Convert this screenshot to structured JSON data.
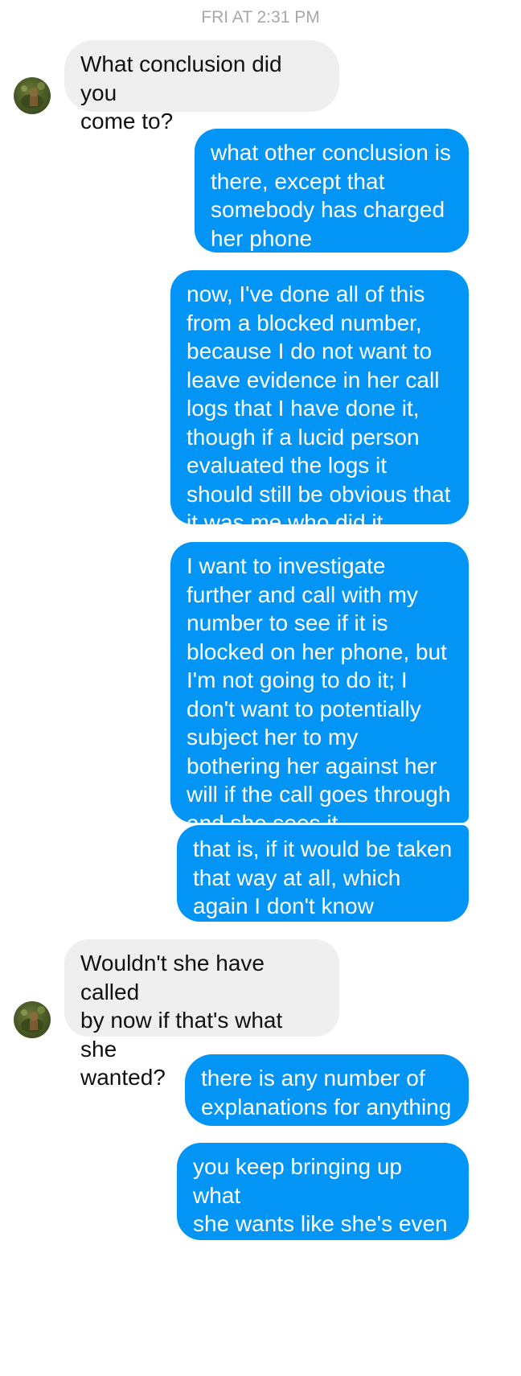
{
  "thread": {
    "timestamp": "FRI AT 2:31 PM",
    "messages": [
      {
        "side": "incoming",
        "text": "What conclusion did you\ncome to?"
      },
      {
        "side": "outgoing",
        "text": "what other conclusion is\nthere, except that\nsomebody has charged\nher phone"
      },
      {
        "side": "outgoing",
        "text": "now, I've done all of this\nfrom a blocked number,\nbecause I do not want to\nleave evidence in her call\nlogs that I have done it,\nthough if a lucid person\nevaluated the logs it\nshould still be obvious that\nit was me who did it"
      },
      {
        "side": "outgoing",
        "text": "I want to investigate\nfurther and call with my\nnumber to see if it is\nblocked on her phone, but\nI'm not going to do it; I\ndon't want to potentially\nsubject her to my\nbothering her against her\nwill if the call goes through\nand she sees it"
      },
      {
        "side": "outgoing",
        "text": "that is, if it would be taken\nthat way at all, which\nagain I don't know"
      },
      {
        "side": "incoming",
        "text": "Wouldn't she have called\nby now if that's what she\nwanted?"
      },
      {
        "side": "outgoing",
        "text": "there is any number of\nexplanations for anything"
      },
      {
        "side": "outgoing",
        "text": "you keep bringing up what\nshe wants like she's even\ndriving the damn car"
      }
    ]
  },
  "colors": {
    "outgoing_bubble": "#0295f5",
    "incoming_bubble": "#efefef",
    "timestamp_text": "#a8a8a8"
  },
  "icons": {
    "avatar": "contact-avatar-photo"
  }
}
